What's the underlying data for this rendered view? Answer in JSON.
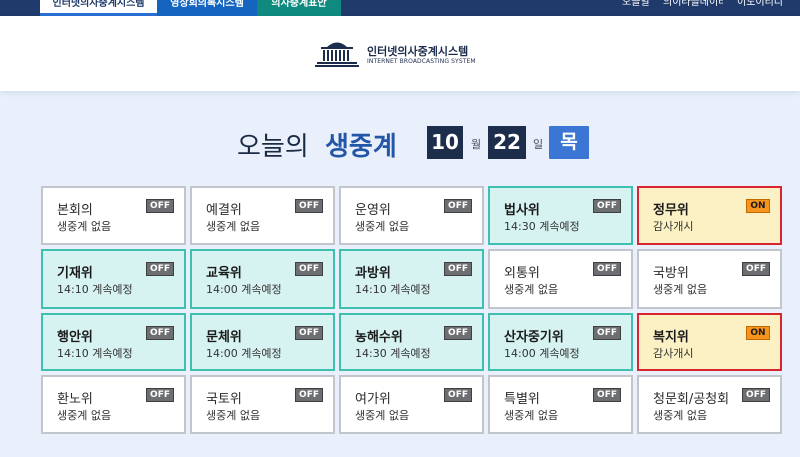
{
  "nav": {
    "tabs": [
      {
        "label": "인터넷의사중계시스템"
      },
      {
        "label": "영상회의록시스템"
      },
      {
        "label": "의사중계표안"
      }
    ],
    "utility": [
      {
        "label": "오늘일"
      },
      {
        "label": "의이라블데이터"
      },
      {
        "label": "이도이리디"
      }
    ]
  },
  "logo": {
    "name_ko": "인터넷의사중계시스템",
    "name_en": "INTERNET BROADCASTING SYSTEM"
  },
  "title": {
    "plain": "오늘의",
    "accent": "생중계"
  },
  "date": {
    "month": "10",
    "month_unit": "월",
    "day": "22",
    "day_unit": "일",
    "weekday": "목"
  },
  "colors": {
    "nav_bg": "#1f3a6b",
    "accent_blue": "#2456a8",
    "scheduled_bg": "#d6f3f1",
    "scheduled_border": "#3ec0b0",
    "live_bg": "#fbf1c4",
    "live_border": "#d9262e",
    "on_badge": "#f7941d",
    "off_badge": "#6d6e71"
  },
  "committees": [
    {
      "name": "본회의",
      "status": "생중계 없음",
      "badge": "OFF",
      "state": "none"
    },
    {
      "name": "예결위",
      "status": "생중계 없음",
      "badge": "OFF",
      "state": "none"
    },
    {
      "name": "운영위",
      "status": "생중계 없음",
      "badge": "OFF",
      "state": "none"
    },
    {
      "name": "법사위",
      "status": "14:30 계속예정",
      "badge": "OFF",
      "state": "scheduled"
    },
    {
      "name": "정무위",
      "status": "감사개시",
      "badge": "ON",
      "state": "live"
    },
    {
      "name": "기재위",
      "status": "14:10 계속예정",
      "badge": "OFF",
      "state": "scheduled"
    },
    {
      "name": "교육위",
      "status": "14:00 계속예정",
      "badge": "OFF",
      "state": "scheduled"
    },
    {
      "name": "과방위",
      "status": "14:10 계속예정",
      "badge": "OFF",
      "state": "scheduled"
    },
    {
      "name": "외통위",
      "status": "생중계 없음",
      "badge": "OFF",
      "state": "none"
    },
    {
      "name": "국방위",
      "status": "생중계 없음",
      "badge": "OFF",
      "state": "none"
    },
    {
      "name": "행안위",
      "status": "14:10 계속예정",
      "badge": "OFF",
      "state": "scheduled"
    },
    {
      "name": "문체위",
      "status": "14:00 계속예정",
      "badge": "OFF",
      "state": "scheduled"
    },
    {
      "name": "농해수위",
      "status": "14:30 계속예정",
      "badge": "OFF",
      "state": "scheduled"
    },
    {
      "name": "산자중기위",
      "status": "14:00 계속예정",
      "badge": "OFF",
      "state": "scheduled"
    },
    {
      "name": "복지위",
      "status": "감사개시",
      "badge": "ON",
      "state": "live"
    },
    {
      "name": "환노위",
      "status": "생중계 없음",
      "badge": "OFF",
      "state": "none"
    },
    {
      "name": "국토위",
      "status": "생중계 없음",
      "badge": "OFF",
      "state": "none"
    },
    {
      "name": "여가위",
      "status": "생중계 없음",
      "badge": "OFF",
      "state": "none"
    },
    {
      "name": "특별위",
      "status": "생중계 없음",
      "badge": "OFF",
      "state": "none"
    },
    {
      "name": "청문회/공청회",
      "status": "생중계 없음",
      "badge": "OFF",
      "state": "none"
    }
  ]
}
